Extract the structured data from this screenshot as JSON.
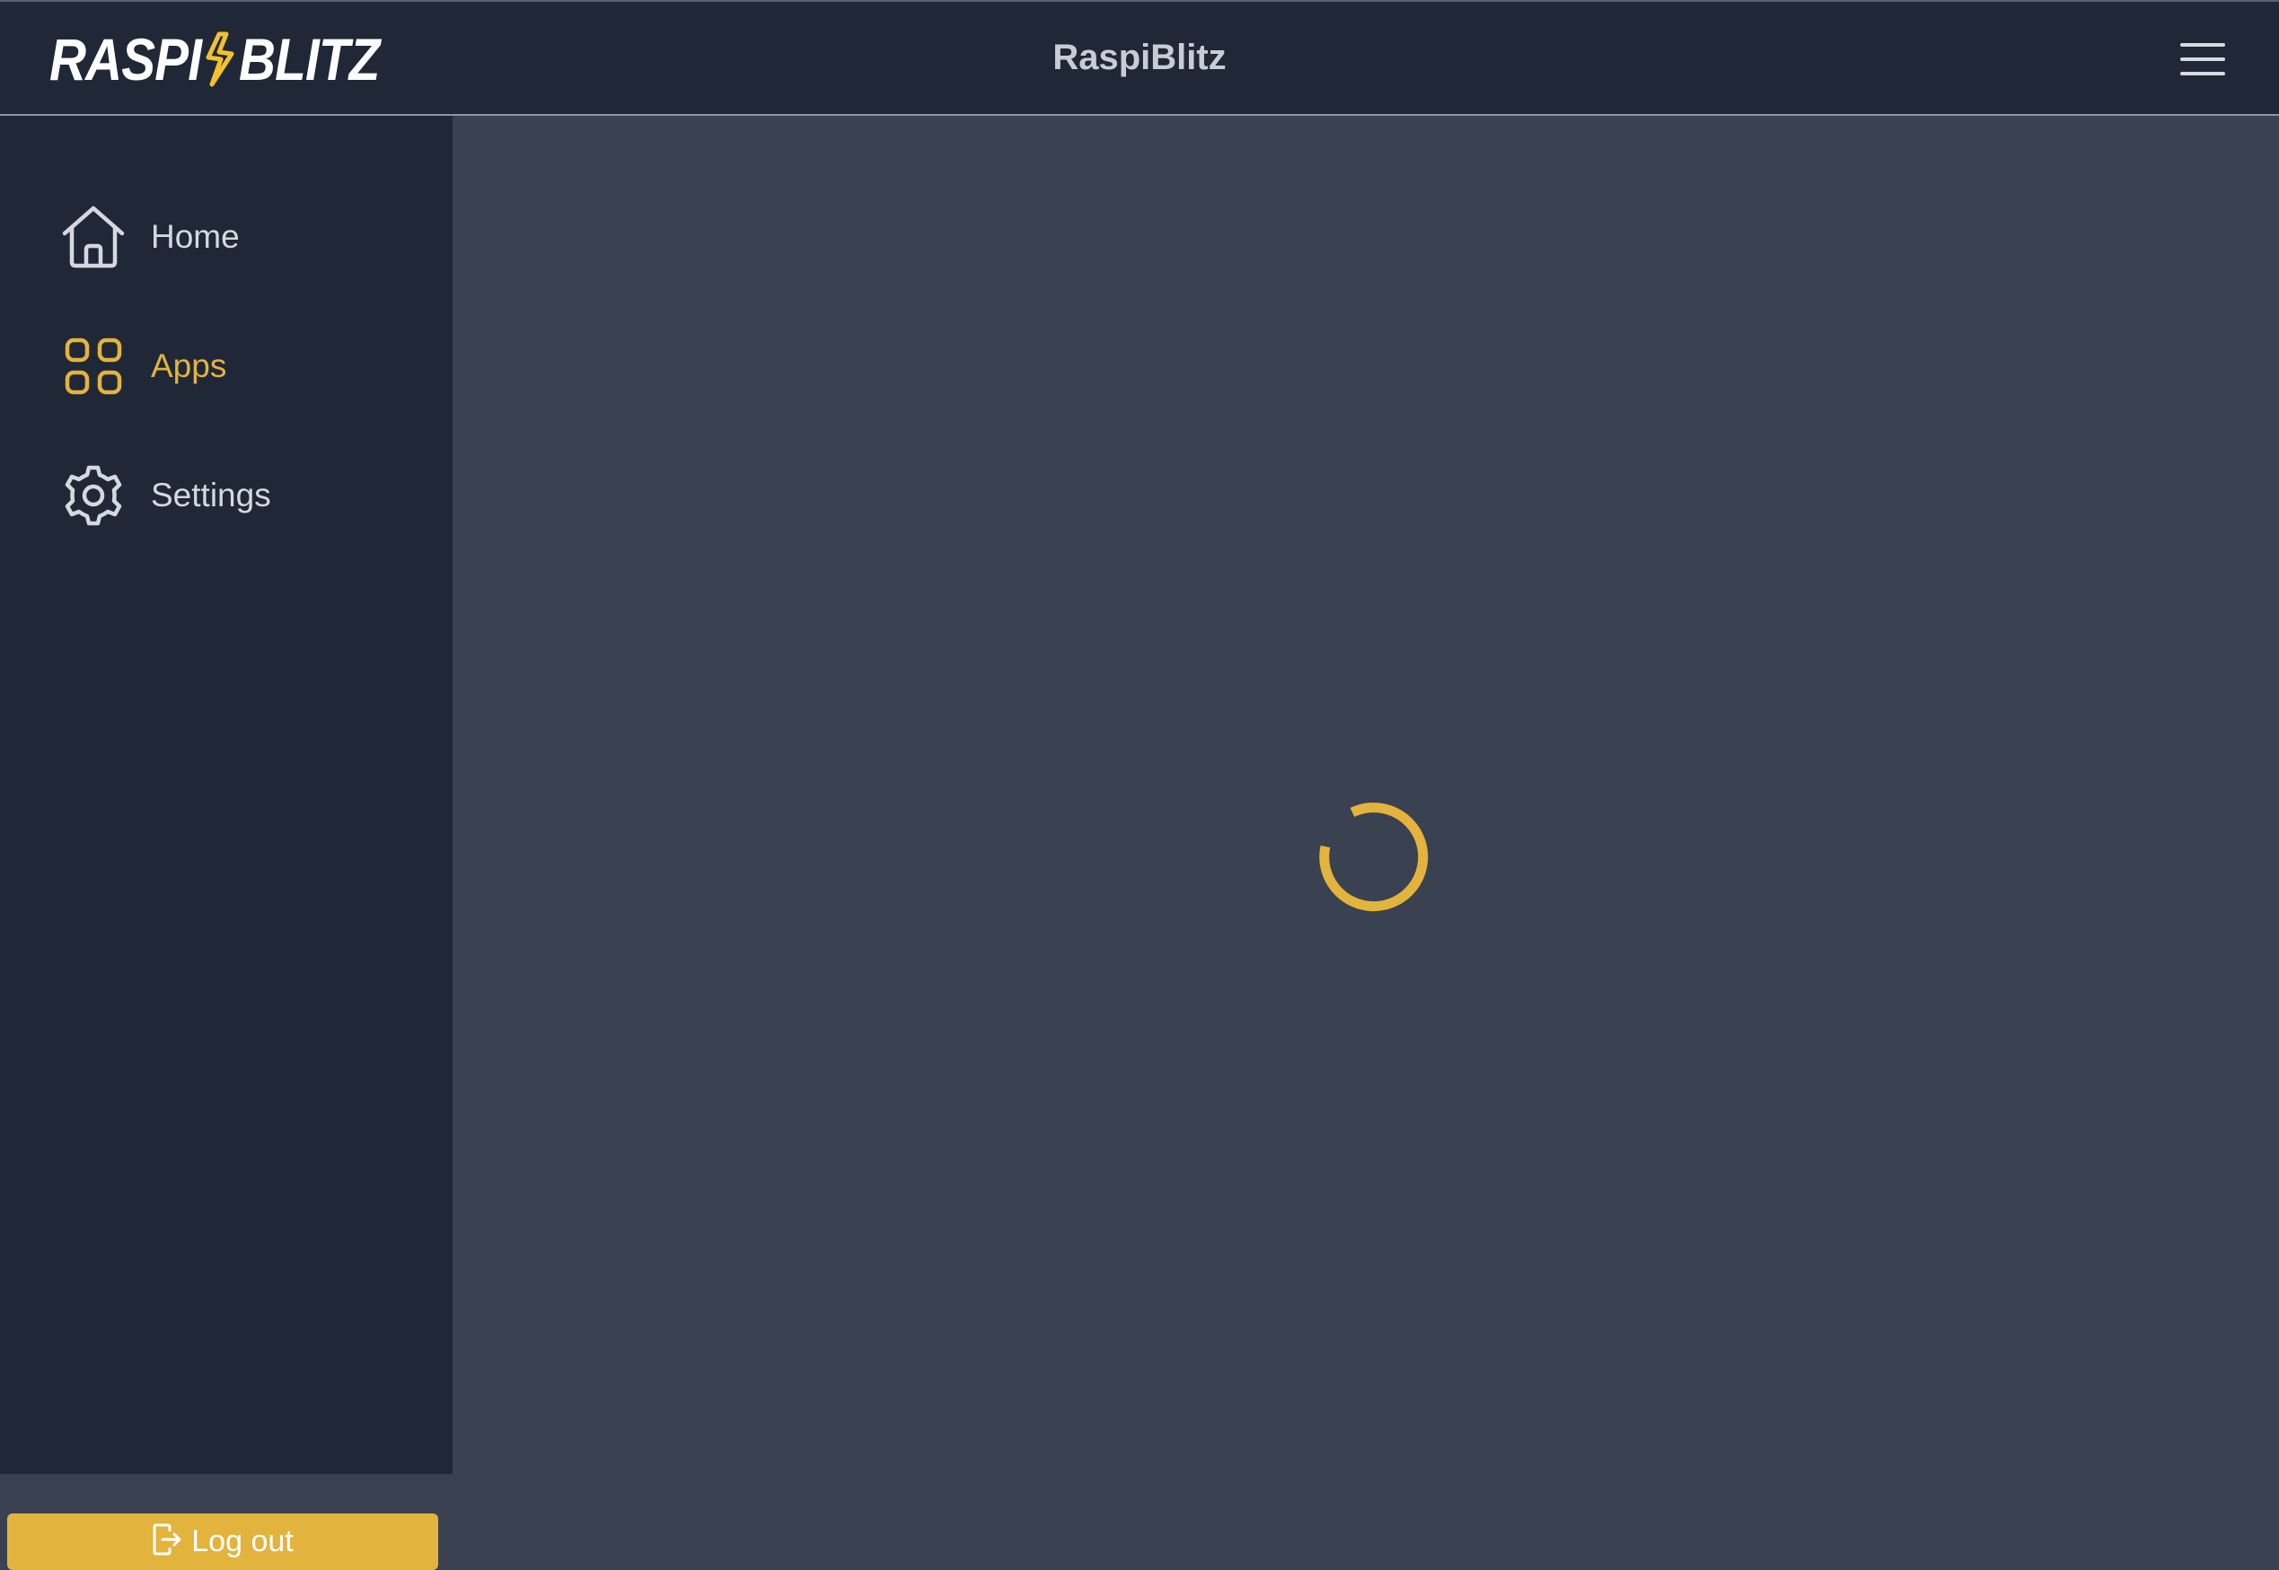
{
  "header": {
    "logo_left": "RASPI",
    "logo_right": "BLITZ",
    "title": "RaspiBlitz",
    "menu_icon": "hamburger-menu-icon"
  },
  "sidebar": {
    "items": [
      {
        "label": "Home",
        "icon": "home-icon",
        "active": false
      },
      {
        "label": "Apps",
        "icon": "apps-grid-icon",
        "active": true
      },
      {
        "label": "Settings",
        "icon": "gear-icon",
        "active": false
      }
    ],
    "logout_label": "Log out",
    "logout_icon": "logout-icon"
  },
  "main": {
    "loading_icon": "loading-spinner-icon"
  },
  "colors": {
    "accent": "#e2b43d",
    "topbar_bg": "#202737",
    "sidebar_bg": "#202737",
    "content_bg": "#3a4150",
    "text_light": "#d5d8de"
  }
}
